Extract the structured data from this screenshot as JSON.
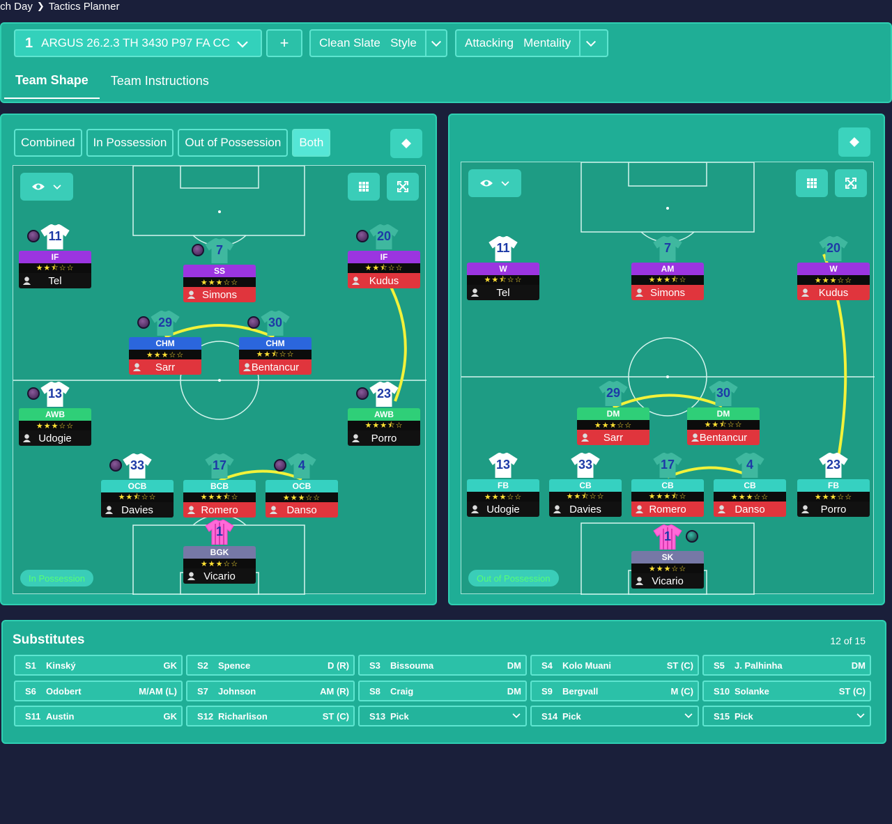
{
  "breadcrumb": {
    "parent": "tch Day",
    "current": "Tactics Planner"
  },
  "tactic": {
    "number": "1",
    "name": "ARGUS 26.2.3 TH 3430 P97 FA CC"
  },
  "style": {
    "a": "Clean Slate",
    "b": "Style"
  },
  "mentality": {
    "a": "Attacking",
    "b": "Mentality"
  },
  "tabs": [
    "Team Shape",
    "Team Instructions"
  ],
  "views": [
    "Combined",
    "In Possession",
    "Out of Possession",
    "Both"
  ],
  "left_pitch_label": "In Possession",
  "right_pitch_label": "Out of Possession",
  "left_players": [
    {
      "num": "11",
      "role": "IF",
      "name": "Tel",
      "stars": "★★⯪☆☆"
    },
    {
      "num": "7",
      "role": "SS",
      "name": "Simons",
      "stars": "★★★☆☆"
    },
    {
      "num": "20",
      "role": "IF",
      "name": "Kudus",
      "stars": "★★⯪☆☆"
    },
    {
      "num": "29",
      "role": "CHM",
      "name": "Sarr",
      "stars": "★★★☆☆"
    },
    {
      "num": "30",
      "role": "CHM",
      "name": "Bentancur",
      "stars": "★★⯪☆☆"
    },
    {
      "num": "13",
      "role": "AWB",
      "name": "Udogie",
      "stars": "★★★☆☆"
    },
    {
      "num": "23",
      "role": "AWB",
      "name": "Porro",
      "stars": "★★★⯪☆"
    },
    {
      "num": "33",
      "role": "OCB",
      "name": "Davies",
      "stars": "★★⯪☆☆"
    },
    {
      "num": "17",
      "role": "BCB",
      "name": "Romero",
      "stars": "★★★⯪☆"
    },
    {
      "num": "4",
      "role": "OCB",
      "name": "Danso",
      "stars": "★★★☆☆"
    },
    {
      "num": "1",
      "role": "BGK",
      "name": "Vicario",
      "stars": "★★★☆☆"
    }
  ],
  "right_players": [
    {
      "num": "11",
      "role": "W",
      "name": "Tel",
      "stars": "★★⯪☆☆"
    },
    {
      "num": "7",
      "role": "AM",
      "name": "Simons",
      "stars": "★★★⯪☆"
    },
    {
      "num": "20",
      "role": "W",
      "name": "Kudus",
      "stars": "★★★☆☆"
    },
    {
      "num": "29",
      "role": "DM",
      "name": "Sarr",
      "stars": "★★★☆☆"
    },
    {
      "num": "30",
      "role": "DM",
      "name": "Bentancur",
      "stars": "★★⯪☆☆"
    },
    {
      "num": "13",
      "role": "FB",
      "name": "Udogie",
      "stars": "★★★☆☆"
    },
    {
      "num": "33",
      "role": "CB",
      "name": "Davies",
      "stars": "★★⯪☆☆"
    },
    {
      "num": "17",
      "role": "CB",
      "name": "Romero",
      "stars": "★★★⯪☆"
    },
    {
      "num": "4",
      "role": "CB",
      "name": "Danso",
      "stars": "★★★☆☆"
    },
    {
      "num": "23",
      "role": "FB",
      "name": "Porro",
      "stars": "★★★☆☆"
    },
    {
      "num": "1",
      "role": "SK",
      "name": "Vicario",
      "stars": "★★★☆☆"
    }
  ],
  "subs": {
    "title": "Substitutes",
    "count": "12 of 15",
    "items": [
      {
        "slot": "S1",
        "name": "Kinský",
        "pos": "GK"
      },
      {
        "slot": "S2",
        "name": "Spence",
        "pos": "D (R)"
      },
      {
        "slot": "S3",
        "name": "Bissouma",
        "pos": "DM"
      },
      {
        "slot": "S4",
        "name": "Kolo Muani",
        "pos": "ST (C)"
      },
      {
        "slot": "S5",
        "name": "J. Palhinha",
        "pos": "DM"
      },
      {
        "slot": "S6",
        "name": "Odobert",
        "pos": "M/AM (L)"
      },
      {
        "slot": "S7",
        "name": "Johnson",
        "pos": "AM (R)"
      },
      {
        "slot": "S8",
        "name": "Craig",
        "pos": "DM"
      },
      {
        "slot": "S9",
        "name": "Bergvall",
        "pos": "M (C)"
      },
      {
        "slot": "S10",
        "name": "Solanke",
        "pos": "ST (C)"
      },
      {
        "slot": "S11",
        "name": "Austin",
        "pos": "GK"
      },
      {
        "slot": "S12",
        "name": "Richarlison",
        "pos": "ST (C)"
      },
      {
        "slot": "S13",
        "name": "Pick",
        "pos": ""
      },
      {
        "slot": "S14",
        "name": "Pick",
        "pos": ""
      },
      {
        "slot": "S15",
        "name": "Pick",
        "pos": ""
      }
    ]
  }
}
